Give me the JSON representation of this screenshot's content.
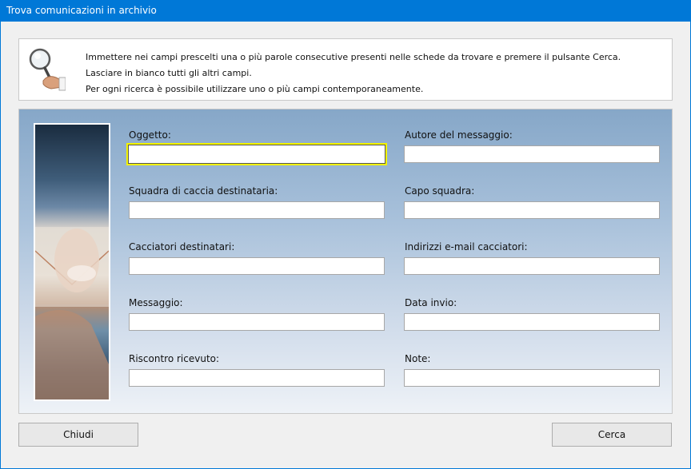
{
  "window": {
    "title": "Trova comunicazioni in archivio"
  },
  "info": {
    "icon": "magnifier-icon",
    "lines": [
      "Immettere nei campi prescelti una o più parole consecutive presenti nelle schede da trovare e premere il pulsante Cerca.",
      "Lasciare in bianco tutti gli altri campi.",
      "Per ogni ricerca è possibile utilizzare uno o più campi contemporaneamente."
    ]
  },
  "fields": {
    "left": [
      {
        "label": "Oggetto:",
        "value": ""
      },
      {
        "label": "Squadra di caccia destinataria:",
        "value": ""
      },
      {
        "label": "Cacciatori destinatari:",
        "value": ""
      },
      {
        "label": "Messaggio:",
        "value": ""
      },
      {
        "label": "Riscontro ricevuto:",
        "value": ""
      }
    ],
    "right": [
      {
        "label": "Autore del messaggio:",
        "value": ""
      },
      {
        "label": "Capo squadra:",
        "value": ""
      },
      {
        "label": "Indirizzi e-mail cacciatori:",
        "value": ""
      },
      {
        "label": "Data invio:",
        "value": ""
      },
      {
        "label": "Note:",
        "value": ""
      }
    ]
  },
  "buttons": {
    "close": "Chiudi",
    "search": "Cerca"
  },
  "colors": {
    "titlebar": "#0078d7",
    "focus": "#f2f200"
  }
}
